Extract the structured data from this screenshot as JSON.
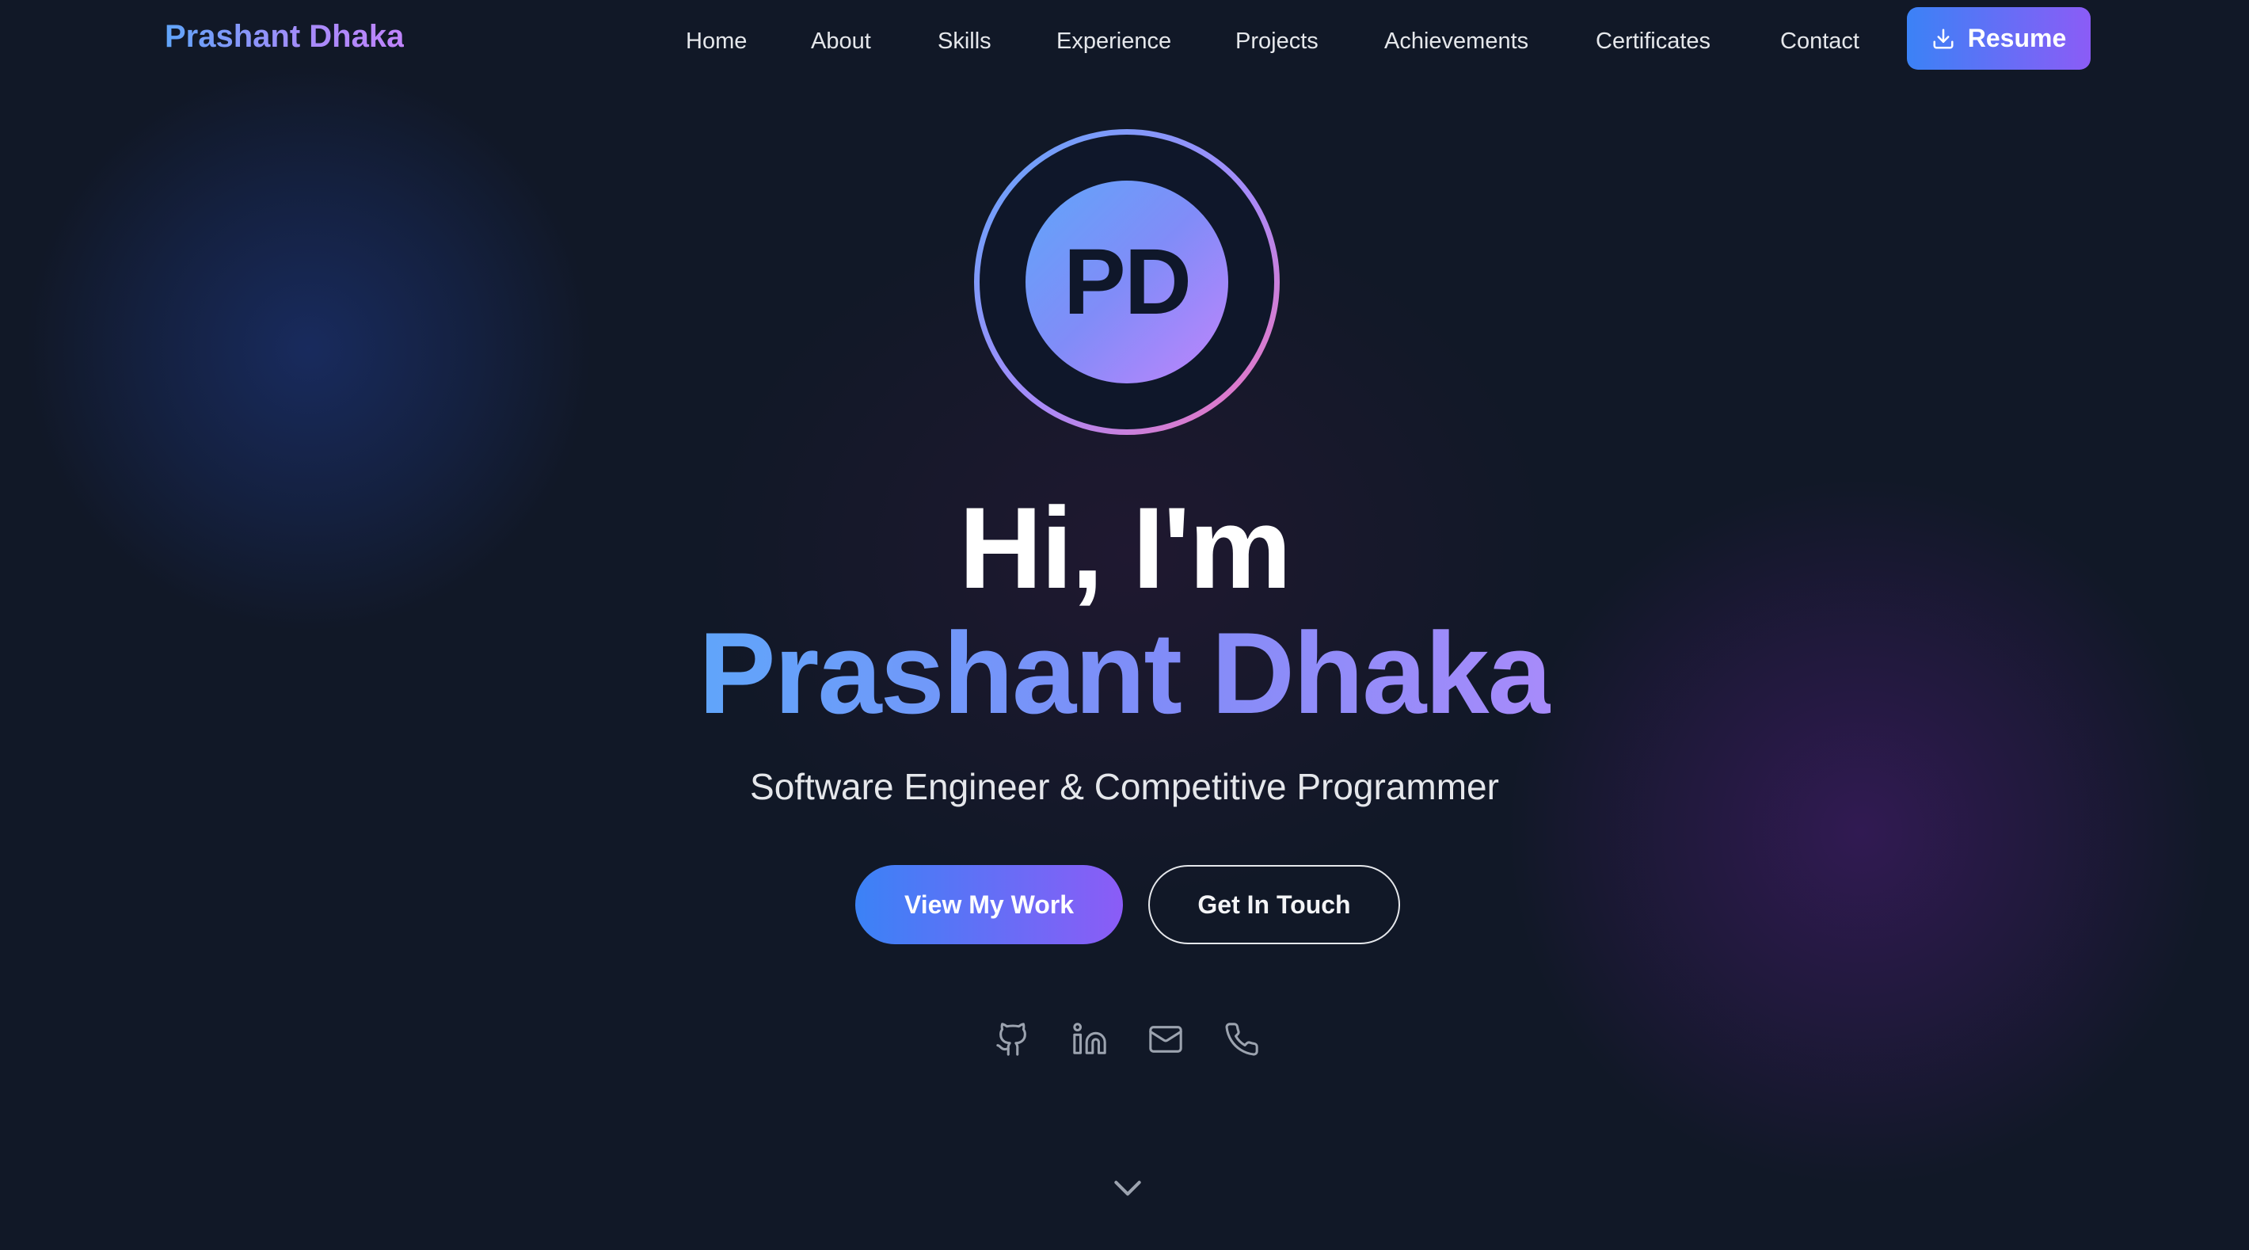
{
  "nav": {
    "logo": "Prashant Dhaka",
    "links": [
      "Home",
      "About",
      "Skills",
      "Experience",
      "Projects",
      "Achievements",
      "Certificates",
      "Contact"
    ],
    "resume_label": "Resume",
    "resume_icon": "download-icon"
  },
  "hero": {
    "avatar_initials": "PD",
    "greeting": "Hi, I'm",
    "name": "Prashant Dhaka",
    "subtitle": "Software Engineer & Competitive Programmer",
    "primary_button": "View My Work",
    "secondary_button": "Get In Touch",
    "social_icons": [
      "github-icon",
      "linkedin-icon",
      "mail-icon",
      "phone-icon"
    ],
    "scroll_icon": "chevron-down-icon"
  },
  "colors": {
    "background": "#111827",
    "accent_start": "#3b82f6",
    "accent_end": "#8b5cf6",
    "text": "#ffffff",
    "muted_text": "#e5e7eb"
  }
}
